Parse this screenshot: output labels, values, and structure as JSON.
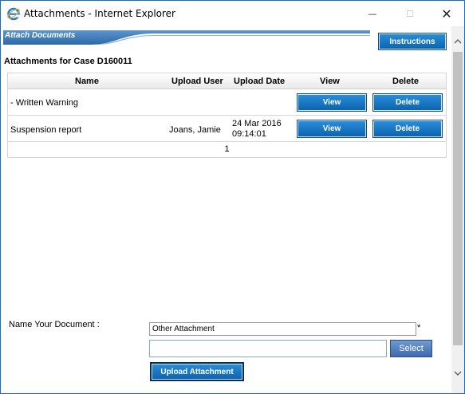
{
  "window": {
    "title": "Attachments - Internet Explorer",
    "minimize": "—",
    "maximize": "☐",
    "close": "✕"
  },
  "header": {
    "band_title": "Attach Documents",
    "instructions_label": "Instructions"
  },
  "case_title": "Attachments for Case D160011",
  "table": {
    "columns": [
      "Name",
      "Upload User",
      "Upload Date",
      "View",
      "Delete"
    ],
    "rows": [
      {
        "name": "- Written Warning",
        "user": "",
        "date_line1": "",
        "date_line2": "",
        "view": "View",
        "delete": "Delete"
      },
      {
        "name": "Suspension report",
        "user": "Joans, Jamie",
        "date_line1": "24 Mar 2016",
        "date_line2": "09:14:01",
        "view": "View",
        "delete": "Delete"
      }
    ],
    "pager": "1"
  },
  "form": {
    "name_label": "Name Your Document :",
    "name_value": "Other Attachment",
    "required_marker": "*",
    "file_value": "",
    "select_label": "Select",
    "upload_label": "Upload Attachment"
  },
  "colors": {
    "button_blue": "#0b61b0",
    "band_blue": "#2f6fae",
    "window_border": "#1a6bbf"
  },
  "icons": {
    "app": "internet-explorer-icon",
    "scroll_up": "chevron-up-icon",
    "scroll_down": "chevron-down-icon"
  }
}
